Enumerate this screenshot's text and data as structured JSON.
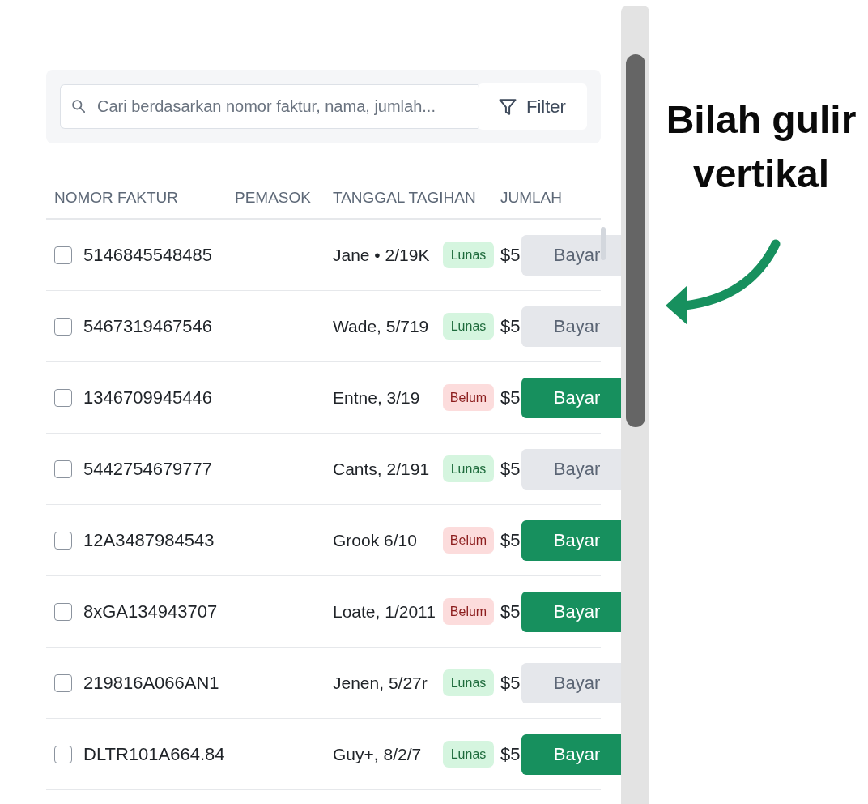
{
  "search": {
    "placeholder": "Cari berdasarkan nomor faktur, nama, jumlah...",
    "filter_label": "Filter"
  },
  "table": {
    "columns": [
      "NOMOR FAKTUR",
      "PEMASOK",
      "TANGGAL TAGIHAN",
      "JUMLAH"
    ],
    "rows": [
      {
        "checked": false,
        "invoice_number": "5146845548485",
        "name_date": "Jane • 2/19K",
        "status": {
          "kind": "paid",
          "label": "Lunas"
        },
        "amount": "$5",
        "pay": {
          "label": "Bayar",
          "disabled": true
        }
      },
      {
        "checked": false,
        "invoice_number": "5467319467546",
        "name_date": "Wade, 5/719",
        "status": {
          "kind": "paid",
          "label": "Lunas"
        },
        "amount": "$5",
        "pay": {
          "label": "Bayar",
          "disabled": true
        }
      },
      {
        "checked": false,
        "invoice_number": "1346709945446",
        "name_date": "Entne, 3/19",
        "status": {
          "kind": "unpaid",
          "label": "Belum"
        },
        "amount": "$5",
        "pay": {
          "label": "Bayar",
          "disabled": false
        }
      },
      {
        "checked": false,
        "invoice_number": "5442754679777",
        "name_date": "Cants, 2/191",
        "status": {
          "kind": "paid",
          "label": "Lunas"
        },
        "amount": "$5",
        "pay": {
          "label": "Bayar",
          "disabled": true
        }
      },
      {
        "checked": false,
        "invoice_number": "12A3487984543",
        "name_date": "Grook 6/10",
        "status": {
          "kind": "unpaid",
          "label": "Belum"
        },
        "amount": "$5",
        "pay": {
          "label": "Bayar",
          "disabled": false
        }
      },
      {
        "checked": false,
        "invoice_number": "8xGA134943707",
        "name_date": "Loate, 1/2011",
        "status": {
          "kind": "unpaid",
          "label": "Belum"
        },
        "amount": "$5",
        "pay": {
          "label": "Bayar",
          "disabled": false
        }
      },
      {
        "checked": false,
        "invoice_number": "219816A066AN1",
        "name_date": "Jenen, 5/27r",
        "status": {
          "kind": "paid",
          "label": "Lunas"
        },
        "amount": "$5",
        "pay": {
          "label": "Bayar",
          "disabled": true
        }
      },
      {
        "checked": false,
        "invoice_number": "DLTR101A664.84",
        "name_date": "Guy+, 8/2/7",
        "status": {
          "kind": "paid",
          "label": "Lunas"
        },
        "amount": "$5",
        "pay": {
          "label": "Bayar",
          "disabled": false
        }
      }
    ]
  },
  "annotation": {
    "text": "Bilah gulir vertikal"
  }
}
